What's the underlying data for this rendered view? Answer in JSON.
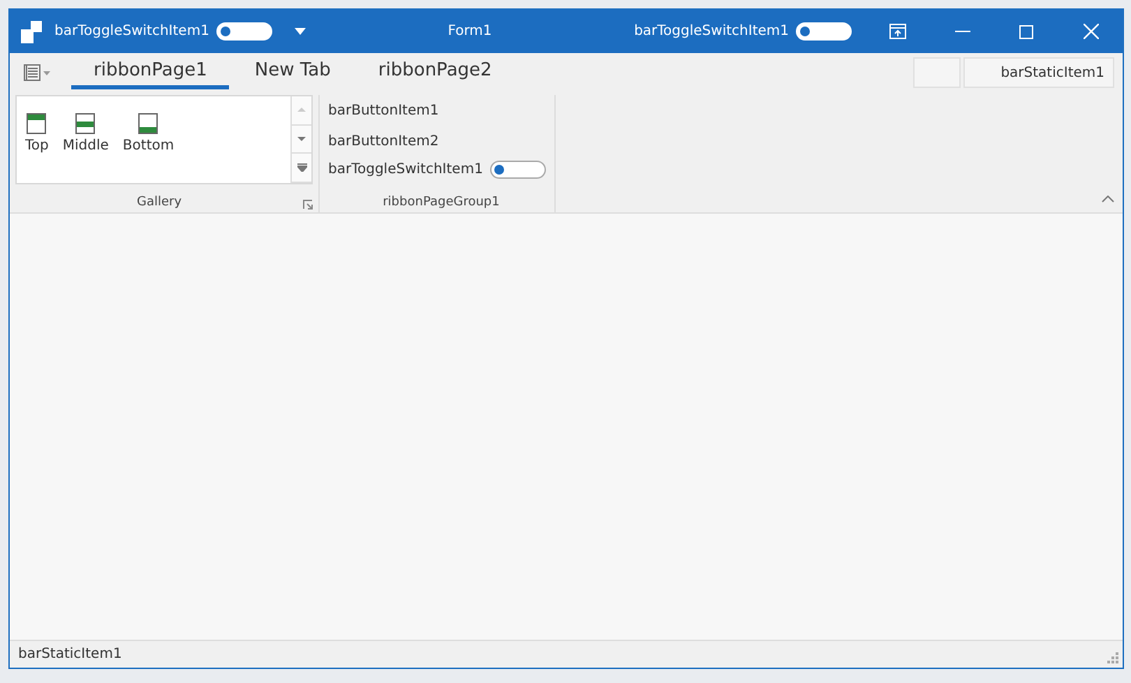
{
  "title_bar": {
    "title": "Form1",
    "left_toggle": {
      "label": "barToggleSwitchItem1",
      "on": false
    },
    "right_toggle": {
      "label": "barToggleSwitchItem1",
      "on": false
    }
  },
  "tabs": [
    {
      "label": "ribbonPage1",
      "selected": true
    },
    {
      "label": "New Tab",
      "selected": false
    },
    {
      "label": "ribbonPage2",
      "selected": false
    }
  ],
  "header_items": [
    {
      "kind": "icon"
    },
    {
      "kind": "static",
      "label": "barStaticItem1"
    }
  ],
  "gallery": {
    "caption": "Gallery",
    "items": [
      {
        "label": "Top",
        "kind": "top"
      },
      {
        "label": "Middle",
        "kind": "middle"
      },
      {
        "label": "Bottom",
        "kind": "bottom"
      }
    ]
  },
  "group": {
    "caption": "ribbonPageGroup1",
    "items": [
      {
        "kind": "button",
        "label": "barButtonItem1"
      },
      {
        "kind": "button",
        "label": "barButtonItem2"
      },
      {
        "kind": "toggle",
        "label": "barToggleSwitchItem1",
        "on": false
      }
    ]
  },
  "status_bar": {
    "text": "barStaticItem1"
  }
}
